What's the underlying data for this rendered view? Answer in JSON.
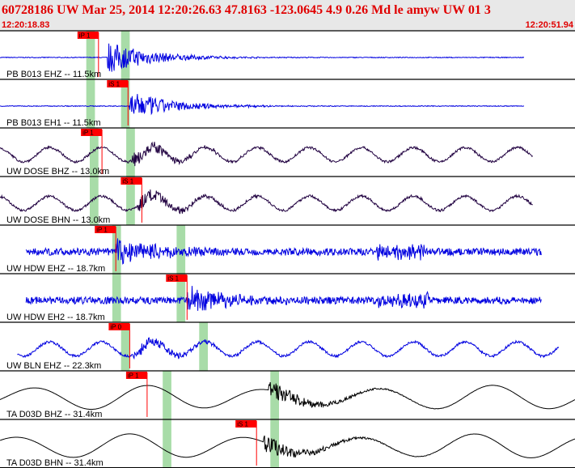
{
  "header": {
    "title": "60728186 UW Mar 25, 2014 12:20:26.63    47.8163 -123.0645  4.9 0.26 Md le amyw UW 01    3",
    "start_time": "12:20:18.83",
    "end_time": "12:20:51.94"
  },
  "colors": {
    "header_bg": "#e8e8e8",
    "header_text": "#e00000",
    "blue_trace": "#0000e0",
    "dark_trace": "#200040",
    "black_trace": "#000000",
    "pick_red": "#ff0000",
    "window_green": "#a8dca8",
    "separator": "#000000"
  },
  "chart_data": {
    "type": "line",
    "time_range": [
      "12:20:18.83",
      "12:20:51.94"
    ],
    "x_range_seconds": [
      18.83,
      51.94
    ],
    "traces": [
      {
        "label": "PB B013 EHZ -- 11.5km",
        "color": "blue",
        "style": "quake",
        "onset": 25.0,
        "end": 49.0,
        "amp": 0.9,
        "pick": {
          "label": "iP 1",
          "time": 24.5
        },
        "windows": [
          [
            23.8,
            24.3
          ],
          [
            25.8,
            26.3
          ]
        ]
      },
      {
        "label": "PB B013 EH1 -- 11.5km",
        "color": "blue",
        "style": "quake",
        "onset": 26.3,
        "end": 49.0,
        "amp": 0.8,
        "pick": {
          "label": "iS 1",
          "time": 26.2
        },
        "windows": [
          [
            23.8,
            24.3
          ],
          [
            25.8,
            26.3
          ]
        ]
      },
      {
        "label": "UW DOSE BHZ -- 13.0km",
        "color": "dark",
        "style": "wave",
        "onset": 26.4,
        "end": 49.5,
        "amp": 0.7,
        "pick": {
          "label": "iP 1",
          "time": 24.7
        },
        "windows": [
          [
            24.0,
            24.5
          ],
          [
            26.1,
            26.6
          ]
        ]
      },
      {
        "label": "UW DOSE BHN -- 13.0km",
        "color": "dark",
        "style": "wave",
        "onset": 26.8,
        "end": 49.5,
        "amp": 0.7,
        "pick": {
          "label": "iS 1",
          "time": 27.0
        },
        "windows": [
          [
            24.0,
            24.5
          ],
          [
            26.1,
            26.6
          ]
        ]
      },
      {
        "label": "UW HDW EHZ -- 18.7km",
        "color": "blue",
        "style": "noise",
        "onset": 25.5,
        "end": 50.0,
        "amp": 0.9,
        "pick": {
          "label": "iP 1",
          "time": 25.5
        },
        "windows": [
          [
            25.3,
            25.8
          ],
          [
            29.0,
            29.5
          ]
        ]
      },
      {
        "label": "UW HDW EH2 -- 18.7km",
        "color": "blue",
        "style": "noise",
        "onset": 29.6,
        "end": 50.0,
        "amp": 0.9,
        "pick": {
          "label": "iS 1",
          "time": 29.6
        },
        "windows": [
          [
            25.3,
            25.8
          ],
          [
            29.0,
            29.5
          ]
        ]
      },
      {
        "label": "UW BLN EHZ -- 22.3km",
        "color": "blue",
        "style": "wave",
        "onset": 26.5,
        "end": 51.0,
        "amp": 0.6,
        "pick": {
          "label": "iP 0",
          "time": 26.3
        },
        "windows": [
          [
            25.8,
            26.3
          ],
          [
            30.3,
            30.8
          ]
        ]
      },
      {
        "label": "TA D03D BHZ -- 31.4km",
        "color": "black",
        "style": "long",
        "onset": 34.3,
        "end": 51.94,
        "amp": 0.7,
        "pick": {
          "label": "iP 1",
          "time": 27.3
        },
        "windows": [
          [
            28.2,
            28.7
          ],
          [
            34.4,
            34.9
          ]
        ]
      },
      {
        "label": "TA D03D BHN -- 31.4km",
        "color": "black",
        "style": "long",
        "onset": 34.0,
        "end": 51.94,
        "amp": 0.7,
        "pick": {
          "label": "iS 1",
          "time": 33.6
        },
        "windows": [
          [
            28.2,
            28.7
          ],
          [
            34.4,
            34.9
          ]
        ]
      }
    ]
  }
}
